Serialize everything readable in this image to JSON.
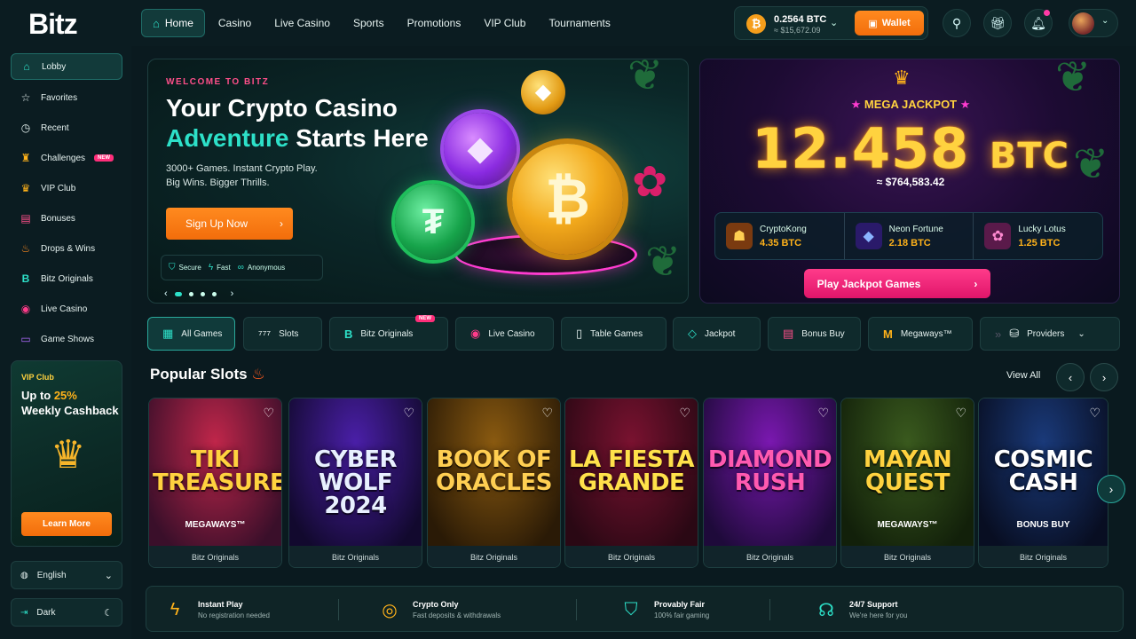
{
  "brand": {
    "logo": "Bitz"
  },
  "nav": {
    "items": [
      {
        "label": "Home",
        "icon": "home-icon"
      },
      {
        "label": "Casino"
      },
      {
        "label": "Live Casino"
      },
      {
        "label": "Sports"
      },
      {
        "label": "Promotions"
      },
      {
        "label": "VIP Club"
      },
      {
        "label": "Tournaments"
      }
    ]
  },
  "wallet": {
    "balance": "0.2564 BTC",
    "balance_usd": "≈ $15,672.09",
    "coin_symbol": "₿",
    "button_label": "Wallet"
  },
  "header_icons": [
    "search-icon",
    "gift-icon",
    "bell-icon"
  ],
  "sidebar": {
    "items": [
      {
        "label": "Lobby",
        "icon": "home-icon"
      },
      {
        "label": "Favorites",
        "icon": "star-icon"
      },
      {
        "label": "Recent",
        "icon": "clock-icon"
      },
      {
        "label": "Challenges",
        "icon": "trophy-icon",
        "badge": "NEW"
      },
      {
        "label": "VIP Club",
        "icon": "crown-icon"
      },
      {
        "label": "Bonuses",
        "icon": "gift-icon"
      },
      {
        "label": "Drops & Wins",
        "icon": "flame-icon"
      },
      {
        "label": "Bitz Originals",
        "icon": "bitz-b-icon"
      },
      {
        "label": "Live Casino",
        "icon": "live-icon"
      },
      {
        "label": "Game Shows",
        "icon": "tv-icon"
      }
    ],
    "vip": {
      "label": "VIP Club",
      "title_prefix": "Up to ",
      "title_highlight": "25%",
      "title_suffix": "Weekly Cashback",
      "button": "Learn More"
    },
    "language": "English",
    "theme": "Dark"
  },
  "hero": {
    "kicker": "WELCOME TO BITZ",
    "line1": "Your Crypto Casino",
    "line2_highlight": "Adventure",
    "line2_rest": " Starts Here",
    "sub1": "3000+ Games. Instant Crypto Play.",
    "sub2": "Big Wins. Bigger Thrills.",
    "cta": "Sign Up Now",
    "trust": [
      "Secure",
      "Fast",
      "Anonymous"
    ],
    "slide_count": 4
  },
  "jackpot": {
    "label": "MEGA JACKPOT",
    "value": "12.458",
    "unit": "BTC",
    "usd": "≈ $764,583.42",
    "winners": [
      {
        "name": "CryptoKong",
        "amount": "4.35 BTC"
      },
      {
        "name": "Neon Fortune",
        "amount": "2.18 BTC"
      },
      {
        "name": "Lucky Lotus",
        "amount": "1.25 BTC"
      }
    ],
    "cta": "Play Jackpot Games"
  },
  "categories": [
    {
      "label": "All Games",
      "icon": "grid-icon"
    },
    {
      "label": "Slots",
      "icon": "slots-icon"
    },
    {
      "label": "Bitz Originals",
      "icon": "bitz-b-icon",
      "badge": "NEW"
    },
    {
      "label": "Live Casino",
      "icon": "live-icon"
    },
    {
      "label": "Table Games",
      "icon": "cards-icon"
    },
    {
      "label": "Jackpot",
      "icon": "diamond-icon"
    },
    {
      "label": "Bonus Buy",
      "icon": "gift-icon"
    },
    {
      "label": "Megaways™",
      "icon": "megaways-icon"
    },
    {
      "label": "Providers",
      "icon": "providers-icon"
    }
  ],
  "popular": {
    "title": "Popular Slots",
    "view_all": "View All",
    "games": [
      {
        "title": "TIKI TREASURE",
        "sub": "MEGAWAYS™",
        "provider": "Bitz Originals",
        "colors": [
          "#c0264a",
          "#3a0f2a"
        ],
        "title_color": "#ffd23f"
      },
      {
        "title": "CYBER WOLF 2024",
        "sub": "",
        "provider": "Bitz Originals",
        "colors": [
          "#4a1fa8",
          "#12092e"
        ],
        "title_color": "#e8f0ff"
      },
      {
        "title": "BOOK OF ORACLES",
        "sub": "",
        "provider": "Bitz Originals",
        "colors": [
          "#8a5a10",
          "#2a1a06"
        ],
        "title_color": "#ffcf52"
      },
      {
        "title": "LA FIESTA GRANDE",
        "sub": "",
        "provider": "Bitz Originals",
        "colors": [
          "#7a1230",
          "#2a0814"
        ],
        "title_color": "#ffe14a"
      },
      {
        "title": "DIAMOND RUSH",
        "sub": "",
        "provider": "Bitz Originals",
        "colors": [
          "#7a18b0",
          "#1e0a3a"
        ],
        "title_color": "#ff5ab0"
      },
      {
        "title": "MAYAN QUEST",
        "sub": "MEGAWAYS™",
        "provider": "Bitz Originals",
        "colors": [
          "#3a5a1e",
          "#12200a"
        ],
        "title_color": "#ffd23f"
      },
      {
        "title": "COSMIC CASH",
        "sub": "BONUS BUY",
        "provider": "Bitz Originals",
        "colors": [
          "#1a3a7a",
          "#080e22"
        ],
        "title_color": "#ffffff"
      }
    ]
  },
  "features": [
    {
      "title": "Instant Play",
      "desc": "No registration needed",
      "icon": "bolt-icon",
      "color": "#ffb21a"
    },
    {
      "title": "Crypto Only",
      "desc": "Fast deposits & withdrawals",
      "icon": "coins-icon",
      "color": "#ffb21a"
    },
    {
      "title": "Provably Fair",
      "desc": "100% fair gaming",
      "icon": "shield-icon",
      "color": "#2de0c8"
    },
    {
      "title": "24/7 Support",
      "desc": "We're here for you",
      "icon": "headset-icon",
      "color": "#2de0c8"
    }
  ]
}
